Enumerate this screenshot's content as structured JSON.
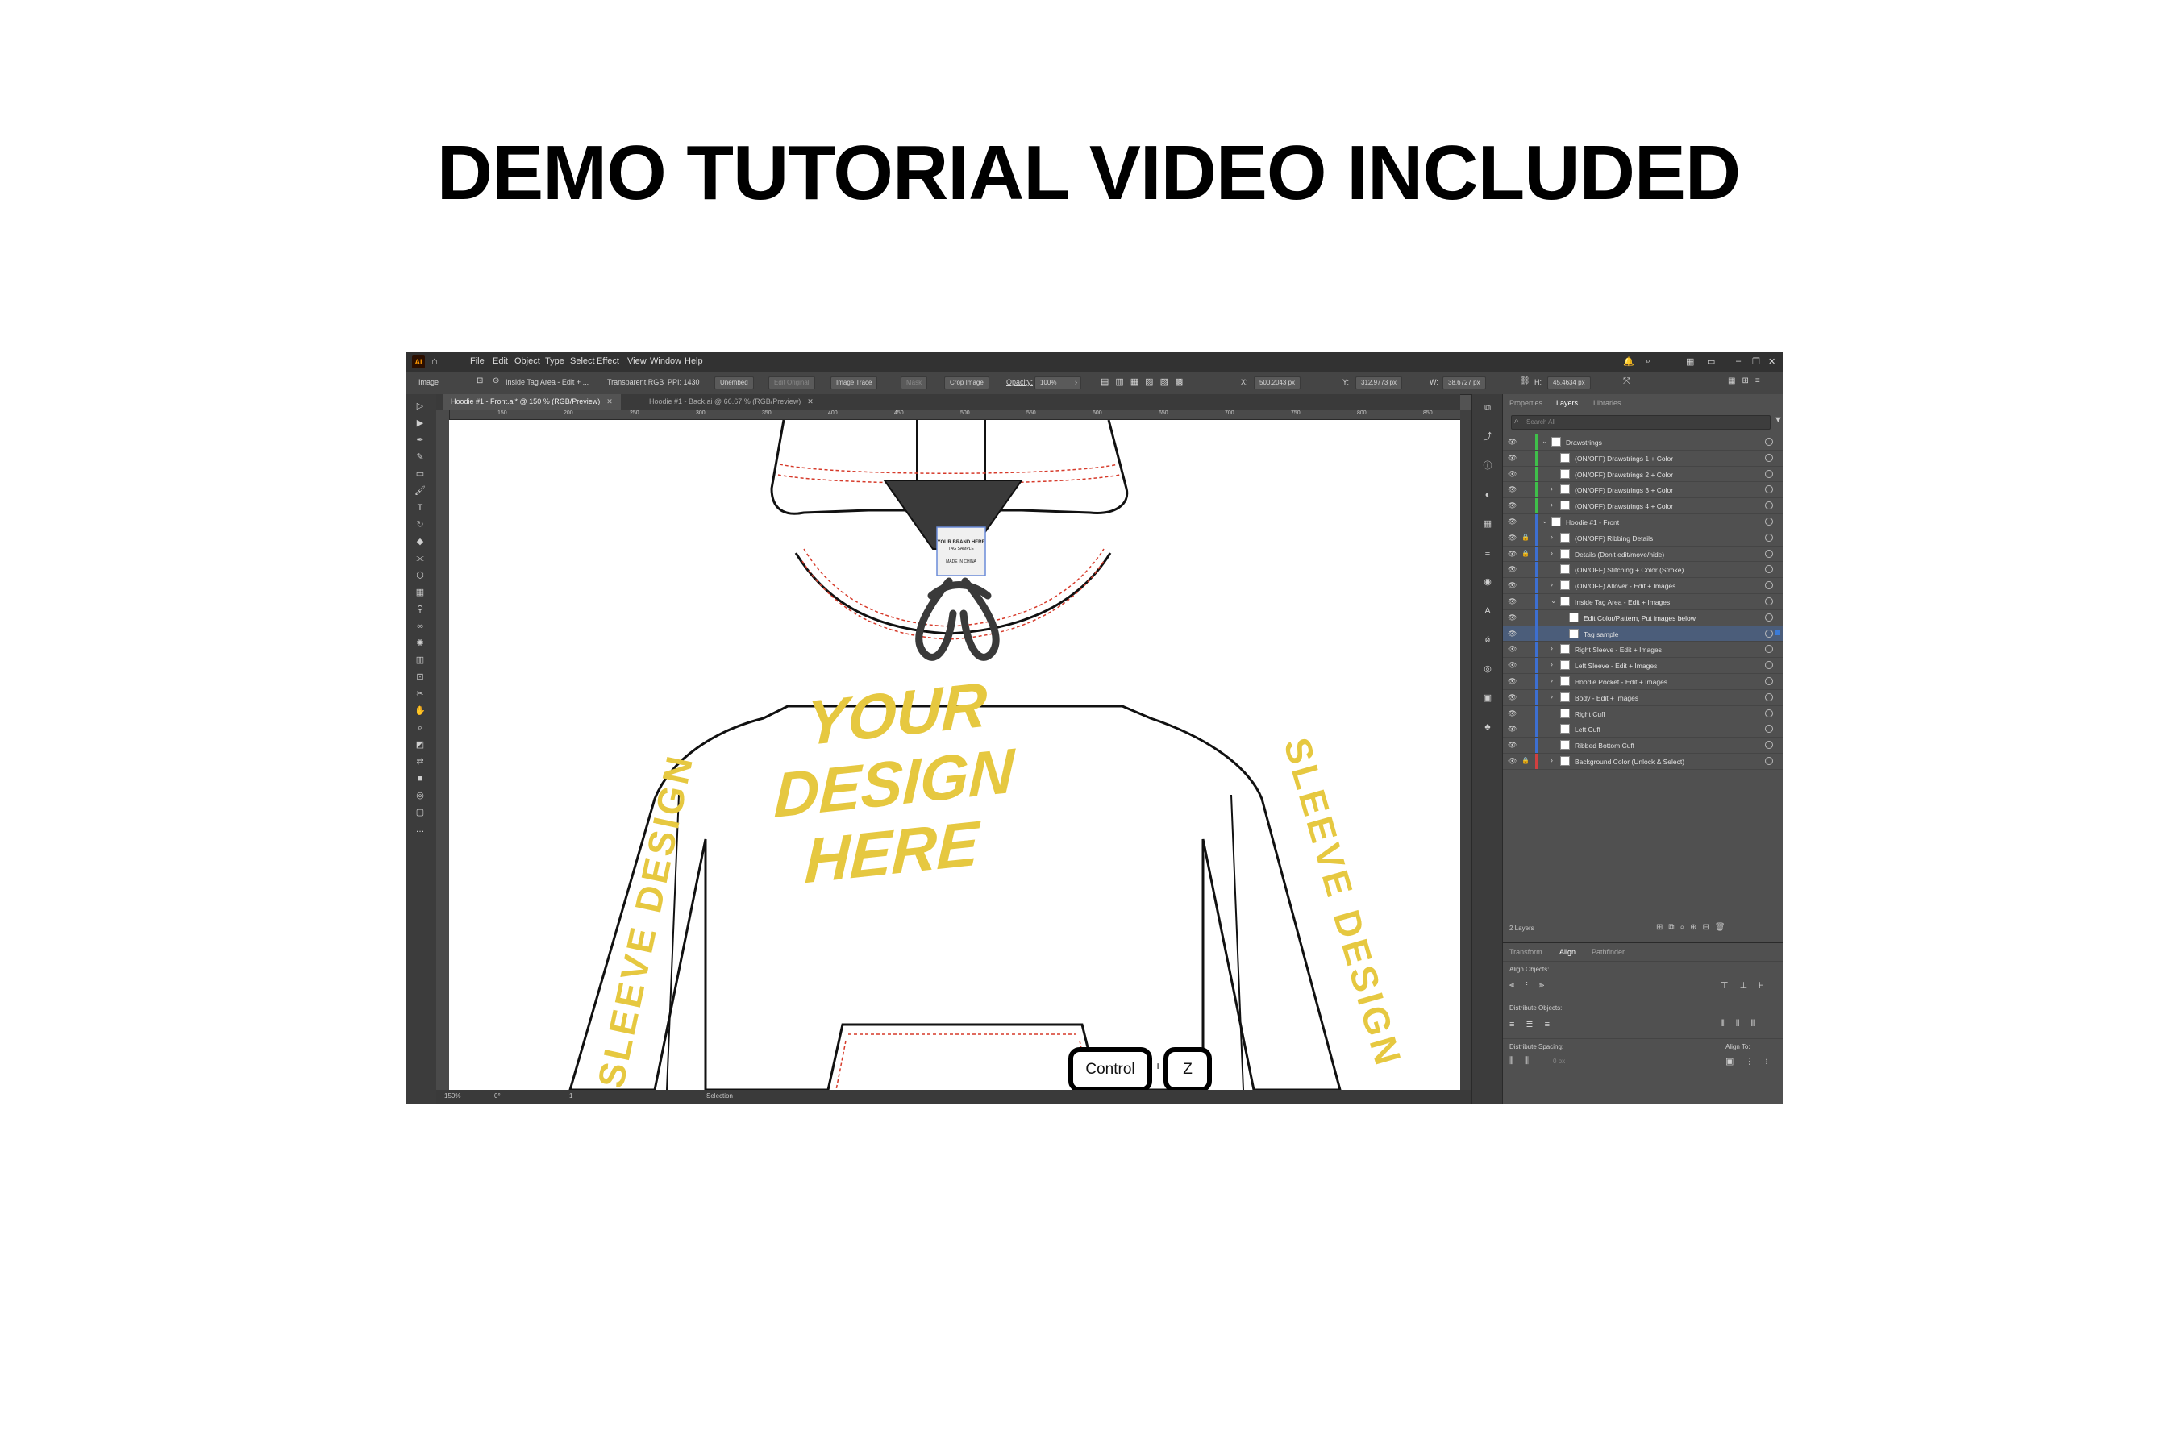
{
  "headline": "DEMO TUTORIAL VIDEO INCLUDED",
  "menu": [
    "File",
    "Edit",
    "Object",
    "Type",
    "Select",
    "Effect",
    "View",
    "Window",
    "Help"
  ],
  "app_logo": "Ai",
  "control_bar": {
    "mode": "Image",
    "layer_name": "Inside Tag Area - Edit + ...",
    "color_mode": "Transparent RGB",
    "ppi": "PPI: 1430",
    "unembed": "Unembed",
    "edit_original": "Edit Original",
    "image_trace": "Image Trace",
    "mask": "Mask",
    "crop_image": "Crop Image",
    "opacity_label": "Opacity:",
    "opacity_value": "100%",
    "x_label": "X:",
    "x_value": "500.2043 px",
    "y_label": "Y:",
    "y_value": "312.9773 px",
    "w_label": "W:",
    "w_value": "38.6727 px",
    "h_label": "H:",
    "h_value": "45.4634 px"
  },
  "tabs": [
    {
      "label": "Hoodie #1 - Front.ai* @ 150 % (RGB/Preview)",
      "active": true
    },
    {
      "label": "Hoodie #1 - Back.ai @ 66.67 % (RGB/Preview)",
      "active": false
    }
  ],
  "ruler_ticks": [
    "150",
    "200",
    "250",
    "300",
    "350",
    "400",
    "450",
    "500",
    "550",
    "600",
    "650",
    "700",
    "750",
    "800",
    "850"
  ],
  "artwork": {
    "front_text": [
      "YOUR",
      "DESIGN",
      "HERE"
    ],
    "left_sleeve_text": "SLEEVE DESIGN",
    "right_sleeve_text": "SLEEVE DESIGN",
    "tag_text": [
      "YOUR BRAND HERE",
      "TAG SAMPLE",
      "MADE IN CHINA"
    ],
    "design_color": "#e6c840"
  },
  "keys": {
    "key1": "Control",
    "plus": "+",
    "key2": "Z"
  },
  "status_bar": {
    "zoom": "150%",
    "rotate": "0°",
    "artboard": "1",
    "tool": "Selection"
  },
  "layers_panel": {
    "tabs": [
      "Properties",
      "Layers",
      "Libraries"
    ],
    "active_tab": "Layers",
    "search_placeholder": "Search All",
    "count": "2 Layers",
    "rows": [
      {
        "name": "Drawstrings",
        "indent": 0,
        "expand": "v",
        "lock": false,
        "color": "#3fbf4a",
        "selected": false,
        "link": false
      },
      {
        "name": "(ON/OFF) Drawstrings 1 + Color",
        "indent": 1,
        "expand": "",
        "lock": false,
        "color": "#3fbf4a",
        "selected": false,
        "link": false
      },
      {
        "name": "(ON/OFF) Drawstrings 2 + Color",
        "indent": 1,
        "expand": "",
        "lock": false,
        "color": "#3fbf4a",
        "selected": false,
        "link": false
      },
      {
        "name": "(ON/OFF) Drawstrings 3 + Color",
        "indent": 1,
        "expand": ">",
        "lock": false,
        "color": "#3fbf4a",
        "selected": false,
        "link": false
      },
      {
        "name": "(ON/OFF) Drawstrings 4 + Color",
        "indent": 1,
        "expand": ">",
        "lock": false,
        "color": "#3fbf4a",
        "selected": false,
        "link": false
      },
      {
        "name": "Hoodie #1 - Front",
        "indent": 0,
        "expand": "v",
        "lock": false,
        "color": "#3d6fd0",
        "selected": false,
        "link": false
      },
      {
        "name": "(ON/OFF) Ribbing Details",
        "indent": 1,
        "expand": ">",
        "lock": true,
        "color": "#3d6fd0",
        "selected": false,
        "link": false
      },
      {
        "name": "Details (Don't edit/move/hide)",
        "indent": 1,
        "expand": ">",
        "lock": true,
        "color": "#3d6fd0",
        "selected": false,
        "link": false
      },
      {
        "name": "(ON/OFF) Stitching + Color (Stroke)",
        "indent": 1,
        "expand": "",
        "lock": false,
        "color": "#3d6fd0",
        "selected": false,
        "link": false
      },
      {
        "name": "(ON/OFF) Allover - Edit + Images",
        "indent": 1,
        "expand": ">",
        "lock": false,
        "color": "#3d6fd0",
        "selected": false,
        "link": false
      },
      {
        "name": "Inside Tag Area - Edit + Images",
        "indent": 1,
        "expand": "v",
        "lock": false,
        "color": "#3d6fd0",
        "selected": false,
        "link": false
      },
      {
        "name": "Edit Color/Pattern, Put images below",
        "indent": 2,
        "expand": "",
        "lock": false,
        "color": "#3d6fd0",
        "selected": false,
        "link": true
      },
      {
        "name": "Tag sample",
        "indent": 2,
        "expand": "",
        "lock": false,
        "color": "#3d6fd0",
        "selected": true,
        "link": false
      },
      {
        "name": "Right Sleeve - Edit + Images",
        "indent": 1,
        "expand": ">",
        "lock": false,
        "color": "#3d6fd0",
        "selected": false,
        "link": false
      },
      {
        "name": "Left Sleeve - Edit + Images",
        "indent": 1,
        "expand": ">",
        "lock": false,
        "color": "#3d6fd0",
        "selected": false,
        "link": false
      },
      {
        "name": "Hoodie Pocket - Edit + Images",
        "indent": 1,
        "expand": ">",
        "lock": false,
        "color": "#3d6fd0",
        "selected": false,
        "link": false
      },
      {
        "name": "Body - Edit + Images",
        "indent": 1,
        "expand": ">",
        "lock": false,
        "color": "#3d6fd0",
        "selected": false,
        "link": false
      },
      {
        "name": "Right Cuff",
        "indent": 1,
        "expand": "",
        "lock": false,
        "color": "#3d6fd0",
        "selected": false,
        "link": false
      },
      {
        "name": "Left Cuff",
        "indent": 1,
        "expand": "",
        "lock": false,
        "color": "#3d6fd0",
        "selected": false,
        "link": false
      },
      {
        "name": "Ribbed Bottom Cuff",
        "indent": 1,
        "expand": "",
        "lock": false,
        "color": "#3d6fd0",
        "selected": false,
        "link": false
      },
      {
        "name": "Background Color (Unlock & Select)",
        "indent": 1,
        "expand": ">",
        "lock": true,
        "color": "#d04040",
        "selected": false,
        "link": false
      }
    ]
  },
  "align_panel": {
    "tabs": [
      "Transform",
      "Align",
      "Pathfinder"
    ],
    "active_tab": "Align",
    "align_objects": "Align Objects:",
    "distribute_objects": "Distribute Objects:",
    "distribute_spacing": "Distribute Spacing:",
    "align_to": "Align To:",
    "spacing_value": "0 px"
  }
}
